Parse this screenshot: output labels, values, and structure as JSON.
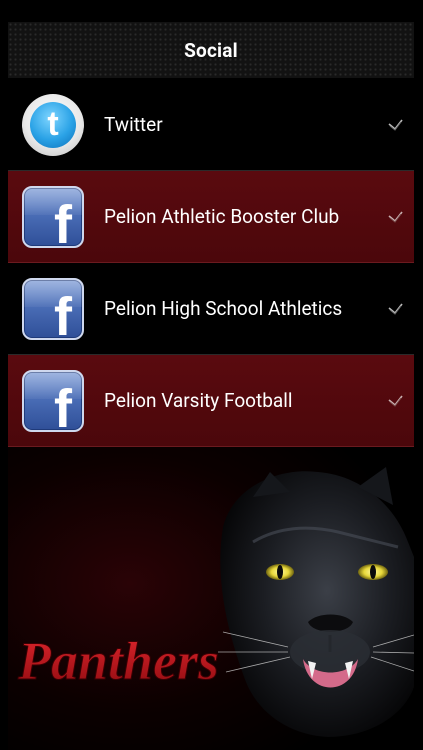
{
  "header": {
    "title": "Social"
  },
  "rows": [
    {
      "label": "Twitter",
      "icon": "twitter-icon",
      "style": "dark"
    },
    {
      "label": "Pelion Athletic Booster Club",
      "icon": "facebook-icon",
      "style": "maroon"
    },
    {
      "label": "Pelion High School Athletics",
      "icon": "facebook-icon",
      "style": "dark"
    },
    {
      "label": "Pelion Varsity Football",
      "icon": "facebook-icon",
      "style": "maroon"
    }
  ],
  "icons": {
    "twitter_letter": "t",
    "facebook_letter": "f"
  },
  "banner": {
    "text": "Panthers"
  },
  "colors": {
    "maroon_row": "#5a0a0f",
    "background": "#000000",
    "text": "#ffffff",
    "banner_red": "#c0141b"
  }
}
